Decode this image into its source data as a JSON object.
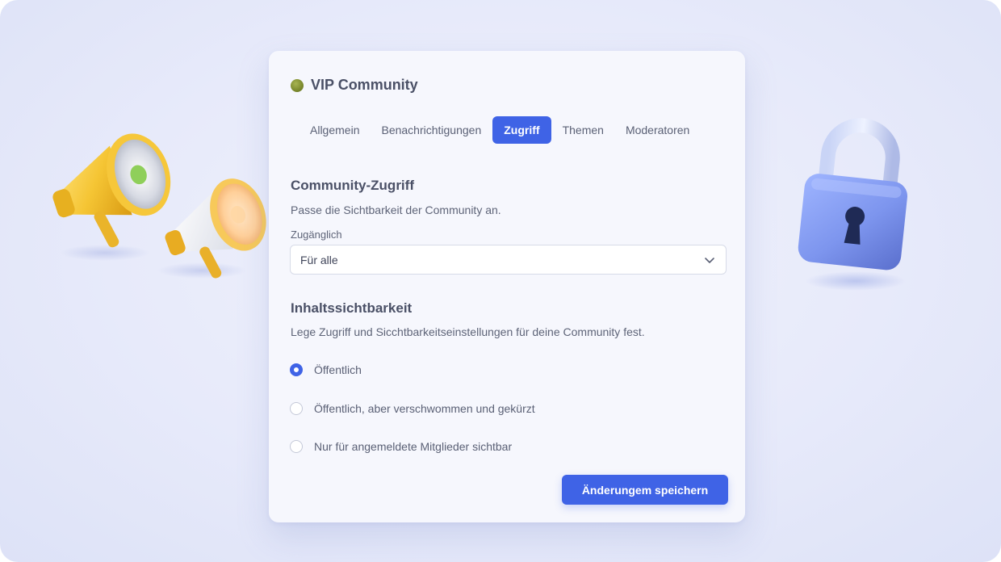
{
  "community": {
    "name": "VIP Community"
  },
  "tabs": [
    {
      "label": "Allgemein",
      "active": false
    },
    {
      "label": "Benachrichtigungen",
      "active": false
    },
    {
      "label": "Zugriff",
      "active": true
    },
    {
      "label": "Themen",
      "active": false
    },
    {
      "label": "Moderatoren",
      "active": false
    }
  ],
  "access": {
    "title": "Community-Zugriff",
    "description": "Passe die Sichtbarkeit der Community an.",
    "field_label": "Zugänglich",
    "selected_value": "Für alle"
  },
  "visibility": {
    "title": "Inhaltssichtbarkeit",
    "description": "Lege Zugriff und Sicchtbarkeitseinstellungen für deine Community fest.",
    "options": [
      {
        "label": "Öffentlich",
        "selected": true
      },
      {
        "label": "Öffentlich, aber verschwommen und gekürzt",
        "selected": false
      },
      {
        "label": "Nur für angemeldete Mitglieder sichtbar",
        "selected": false
      }
    ]
  },
  "save_button": {
    "label": "Änderungem speichern"
  },
  "colors": {
    "accent": "#3f63e6",
    "background": "#e7eafa",
    "card": "#f6f7fd",
    "text_primary": "#4a5066",
    "text_secondary": "#5e6478"
  },
  "icons": {
    "community": "community-avatar-dot",
    "select": "chevron-down-icon",
    "illustration_left": "megaphone-icon",
    "illustration_right": "padlock-icon"
  }
}
